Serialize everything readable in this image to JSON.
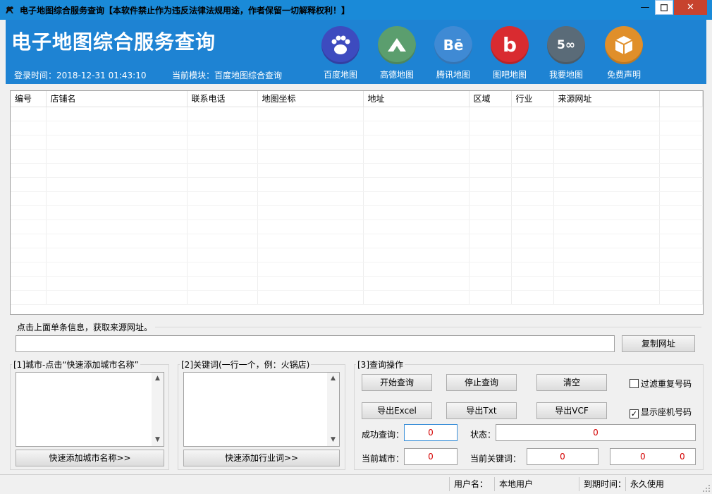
{
  "window": {
    "title": "电子地图综合服务查询【本软件禁止作为违反法律法规用途，作者保留一切解释权利！】",
    "min_glyph": "—",
    "close_glyph": "✕"
  },
  "header": {
    "app_title": "电子地图综合服务查询",
    "login_label": "登录时间：",
    "login_time": "2018-12-31 01:43:10",
    "module_label": "当前模块：",
    "module_value": "百度地图综合查询",
    "nav": [
      {
        "label": "百度地图",
        "icon": "paw-icon",
        "color": "#3d4bbf",
        "glyph": "🐾"
      },
      {
        "label": "高德地图",
        "icon": "mountain-icon",
        "color": "#5b9e6e",
        "glyph": "⛰"
      },
      {
        "label": "腾讯地图",
        "icon": "behance-icon",
        "color": "#3f8ad4",
        "glyph": "Bē"
      },
      {
        "label": "图吧地图",
        "icon": "b-icon",
        "color": "#d92b30",
        "glyph": "b"
      },
      {
        "label": "我要地图",
        "icon": "500-icon",
        "color": "#5a6b78",
        "glyph": "5∞"
      },
      {
        "label": "免费声明",
        "icon": "box-icon",
        "color": "#e08f2a",
        "glyph": "▣"
      }
    ]
  },
  "table": {
    "columns": [
      "编号",
      "店铺名",
      "联系电话",
      "地图坐标",
      "地址",
      "区域",
      "行业",
      "来源网址",
      ""
    ]
  },
  "source": {
    "hint": "点击上面单条信息，获取来源网址。",
    "url_value": "",
    "copy_button": "复制网址"
  },
  "cities": {
    "group_title": "[1]城市-点击“快速添加城市名称”",
    "add_button": "快速添加城市名称>>"
  },
  "keywords": {
    "group_title": "[2]关键词(一行一个，例：火锅店)",
    "add_button": "快速添加行业词>>"
  },
  "ops": {
    "group_title": "[3]查询操作",
    "start": "开始查询",
    "stop": "停止查询",
    "clear": "清空",
    "filter_dup_label": "过滤重复号码",
    "filter_dup_checked": false,
    "export_excel": "导出Excel",
    "export_txt": "导出Txt",
    "export_vcf": "导出VCF",
    "show_landline_label": "显示座机号码",
    "show_landline_checked": true,
    "success_label": "成功查询：",
    "success_value": "0",
    "status_label": "状态：",
    "status_value": "0",
    "city_label": "当前城市：",
    "city_value": "0",
    "keyword_label": "当前关键词：",
    "keyword_value": "0",
    "progress_a": "0",
    "progress_b": "0"
  },
  "statusbar": {
    "user_label": "用户名：",
    "user_value": "本地用户",
    "expire_label": "到期时间：",
    "expire_value": "永久使用"
  }
}
